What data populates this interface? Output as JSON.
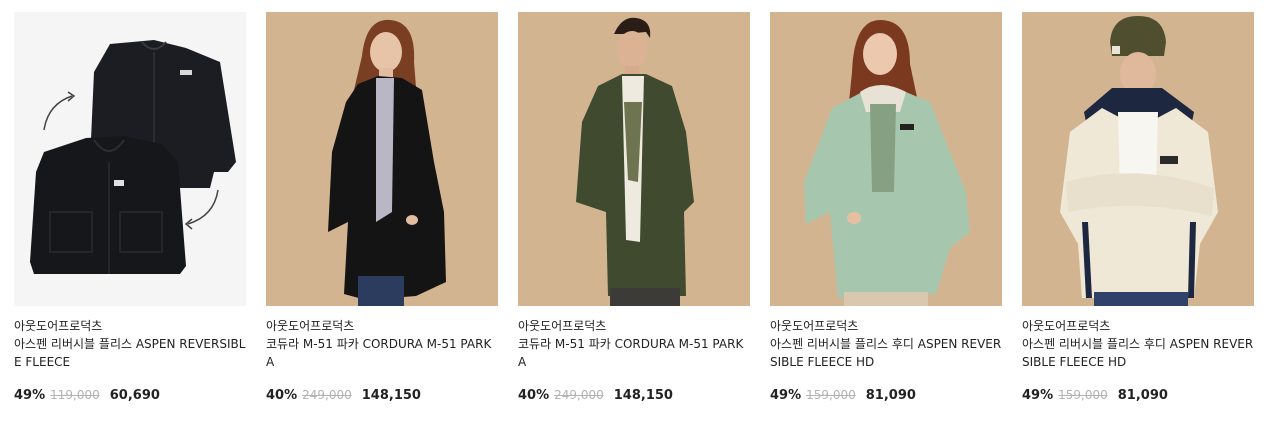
{
  "products": [
    {
      "brand": "아웃도어프로덕츠",
      "name": "아스펜 리버시블 플리스 ASPEN REVERSIBLE FLEECE",
      "discount": "49%",
      "original_price": "119,000",
      "sale_price": "60,690",
      "image": "black-reversible-fleece-flatlay"
    },
    {
      "brand": "아웃도어프로덕츠",
      "name": "코듀라 M-51 파카 CORDURA M-51 PARKA",
      "discount": "40%",
      "original_price": "249,000",
      "sale_price": "148,150",
      "image": "model-black-parka"
    },
    {
      "brand": "아웃도어프로덕츠",
      "name": "코듀라 M-51 파카 CORDURA M-51 PARKA",
      "discount": "40%",
      "original_price": "249,000",
      "sale_price": "148,150",
      "image": "model-olive-parka"
    },
    {
      "brand": "아웃도어프로덕츠",
      "name": "아스펜 리버시블 플리스 후디 ASPEN REVERSIBLE FLEECE HD",
      "discount": "49%",
      "original_price": "159,000",
      "sale_price": "81,090",
      "image": "model-mint-hoodie"
    },
    {
      "brand": "아웃도어프로덕츠",
      "name": "아스펜 리버시블 플리스 후디 ASPEN REVERSIBLE FLEECE HD",
      "discount": "49%",
      "original_price": "159,000",
      "sale_price": "81,090",
      "image": "model-ivory-fleece-hoodie"
    }
  ],
  "colors": {
    "studio_bg": "#d3b491",
    "flat_bg": "#f5f5f5",
    "strike_gray": "#b3b3b3"
  }
}
